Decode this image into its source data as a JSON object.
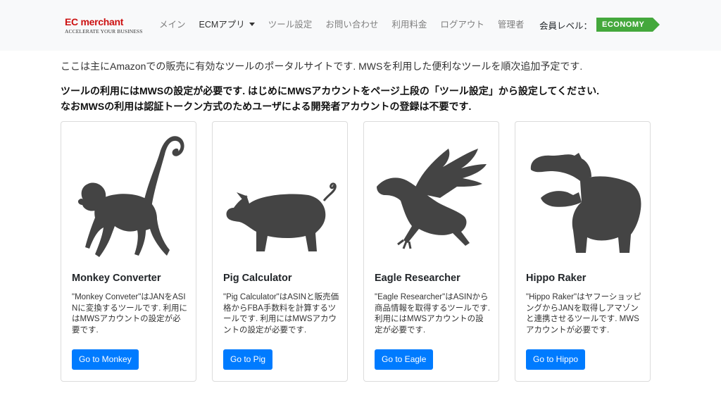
{
  "brand": {
    "logo": "EC merchant",
    "tagline": "ACCELERATE YOUR BUSINESS"
  },
  "nav": {
    "items": [
      {
        "label": "メイン",
        "active": false,
        "dropdown": false
      },
      {
        "label": "ECMアプリ",
        "active": true,
        "dropdown": true
      },
      {
        "label": "ツール設定",
        "active": false,
        "dropdown": false
      },
      {
        "label": "お問い合わせ",
        "active": false,
        "dropdown": false
      },
      {
        "label": "利用料金",
        "active": false,
        "dropdown": false
      },
      {
        "label": "ログアウト",
        "active": false,
        "dropdown": false
      },
      {
        "label": "管理者",
        "active": false,
        "dropdown": false
      }
    ],
    "member_label": "会員レベル：",
    "member_level": "ECONOMY"
  },
  "intro": "ここは主にAmazonでの販売に有効なツールのポータルサイトです. MWSを利用した便利なツールを順次追加予定です.",
  "notice": {
    "line1": "ツールの利用にはMWSの設定が必要です. はじめにMWSアカウントをページ上段の「ツール設定」から設定してください.",
    "line2": "なおMWSの利用は認証トークン方式のためユーザによる開発者アカウントの登録は不要です."
  },
  "cards": [
    {
      "icon": "monkey-icon",
      "title": "Monkey Converter",
      "text": "\"Monkey Conveter\"はJANをASINに変換するツールです. 利用にはMWSアカウントの設定が必要です.",
      "button": "Go to Monkey"
    },
    {
      "icon": "pig-icon",
      "title": "Pig Calculator",
      "text": "\"Pig Calculator\"はASINと販売価格からFBA手数料を計算するツールです. 利用にはMWSアカウントの設定が必要です.",
      "button": "Go to Pig"
    },
    {
      "icon": "eagle-icon",
      "title": "Eagle Researcher",
      "text": "\"Eagle Researcher\"はASINから商品情報を取得するツールです. 利用にはMWSアカウントの設定が必要です.",
      "button": "Go to Eagle"
    },
    {
      "icon": "hippo-icon",
      "title": "Hippo Raker",
      "text": "\"Hippo Raker\"はヤフーショッピングからJANを取得しアマゾンと連携させるツールです. MWSアカウントが必要です.",
      "button": "Go to Hippo"
    }
  ],
  "colors": {
    "accent": "#007bff",
    "badge": "#44a83c",
    "logo": "#cc1111",
    "navbar_bg": "#f8f9fa",
    "silhouette": "#444444"
  }
}
